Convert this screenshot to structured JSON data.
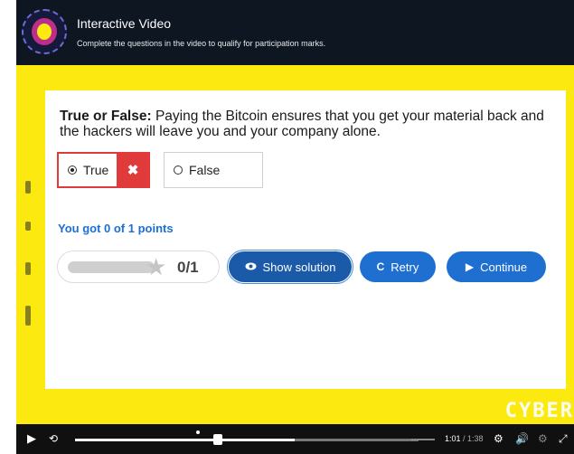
{
  "header": {
    "title": "Interactive Video",
    "subtitle": "Complete the questions in the video to qualify for participation marks."
  },
  "question": {
    "lead": "True or False:",
    "text": " Paying the Bitcoin ensures that you get your material back and the hackers will leave you and your company alone."
  },
  "options": {
    "true_label": "True",
    "false_label": "False",
    "wrong_mark": "✖"
  },
  "feedback": {
    "score_text": "You got 0 of 1 points",
    "progress_text": "0/1",
    "progress_fraction": 0
  },
  "buttons": {
    "show_solution": "Show solution",
    "retry": "Retry",
    "continue": "Continue"
  },
  "watermark": "CYBER",
  "player": {
    "current_time": "1:01",
    "duration": "/ 1:38",
    "played_fraction": 0.64
  },
  "colors": {
    "accent": "#1f6fd0",
    "wrong": "#e03a3a",
    "background": "#fbe90f",
    "score_text": "#1b6fd6"
  }
}
